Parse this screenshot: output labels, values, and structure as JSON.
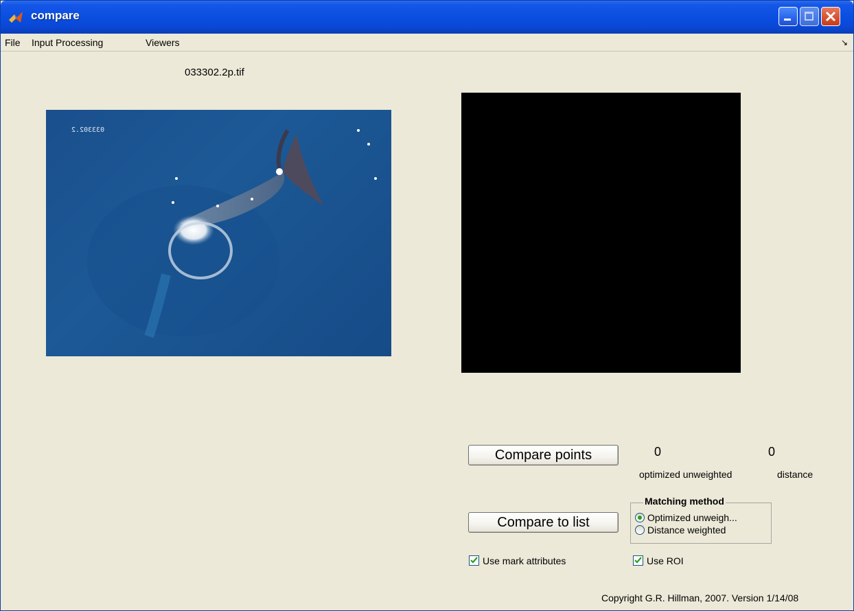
{
  "window": {
    "title": "compare",
    "app_icon": "matlab-icon",
    "controls": {
      "minimize": "minimize-icon",
      "maximize": "maximize-icon",
      "close": "close-icon"
    }
  },
  "menubar": {
    "items": [
      {
        "label": "File"
      },
      {
        "label": "Input Processing"
      },
      {
        "label": "Viewers"
      }
    ],
    "dock_icon": "dock-arrow-icon"
  },
  "image_panel": {
    "filename": "033302.2p.tif",
    "overlay_text": "033302.2"
  },
  "buttons": {
    "compare_points": "Compare points",
    "compare_to_list": "Compare to list"
  },
  "results": {
    "unweighted_value": "0",
    "distance_value": "0",
    "unweighted_label": "optimized unweighted",
    "distance_label": "distance"
  },
  "matching_method": {
    "title": "Matching method",
    "options": [
      {
        "label": "Optimized unweigh...",
        "selected": true
      },
      {
        "label": "Distance weighted",
        "selected": false
      }
    ]
  },
  "checkboxes": {
    "use_mark_attributes": {
      "label": "Use mark attributes",
      "checked": true
    },
    "use_roi": {
      "label": "Use ROI",
      "checked": true
    }
  },
  "footer": {
    "copyright": "Copyright G.R. Hillman, 2007. Version 1/14/08"
  },
  "colors": {
    "titlebar": "#0a4fe0",
    "background": "#ece9d8",
    "photo_water": "#1c5996",
    "check_green": "#21a121"
  }
}
